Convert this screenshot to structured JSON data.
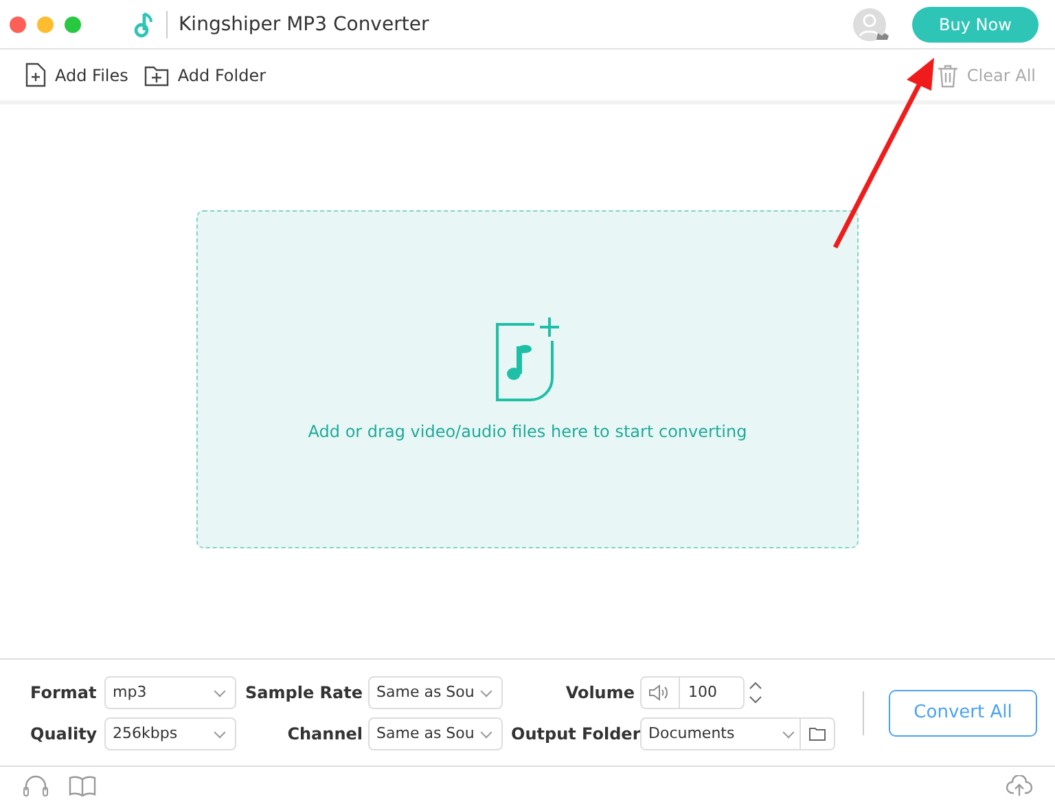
{
  "window": {
    "title": "Kingshiper MP3 Converter"
  },
  "header": {
    "buy_button": "Buy Now"
  },
  "toolbar": {
    "items": [
      {
        "label": "Add Files",
        "kind": "file",
        "disabled": false
      },
      {
        "label": "Add Folder",
        "kind": "folder",
        "disabled": false
      }
    ],
    "clear": {
      "label": "Clear All",
      "disabled": true
    }
  },
  "drop_zone": {
    "message": "Add or drag video/audio files here to start converting"
  },
  "settings": {
    "format": {
      "label": "Format",
      "value": "mp3"
    },
    "quality": {
      "label": "Quality",
      "value": "256kbps"
    },
    "sample_rate": {
      "label": "Sample Rate",
      "value": "Same as Sou"
    },
    "channel": {
      "label": "Channel",
      "value": "Same as Sou"
    },
    "volume": {
      "label": "Volume",
      "value": "100"
    },
    "output_folder": {
      "label": "Output Folder",
      "value": "Documents"
    },
    "convert_button": "Convert All"
  }
}
